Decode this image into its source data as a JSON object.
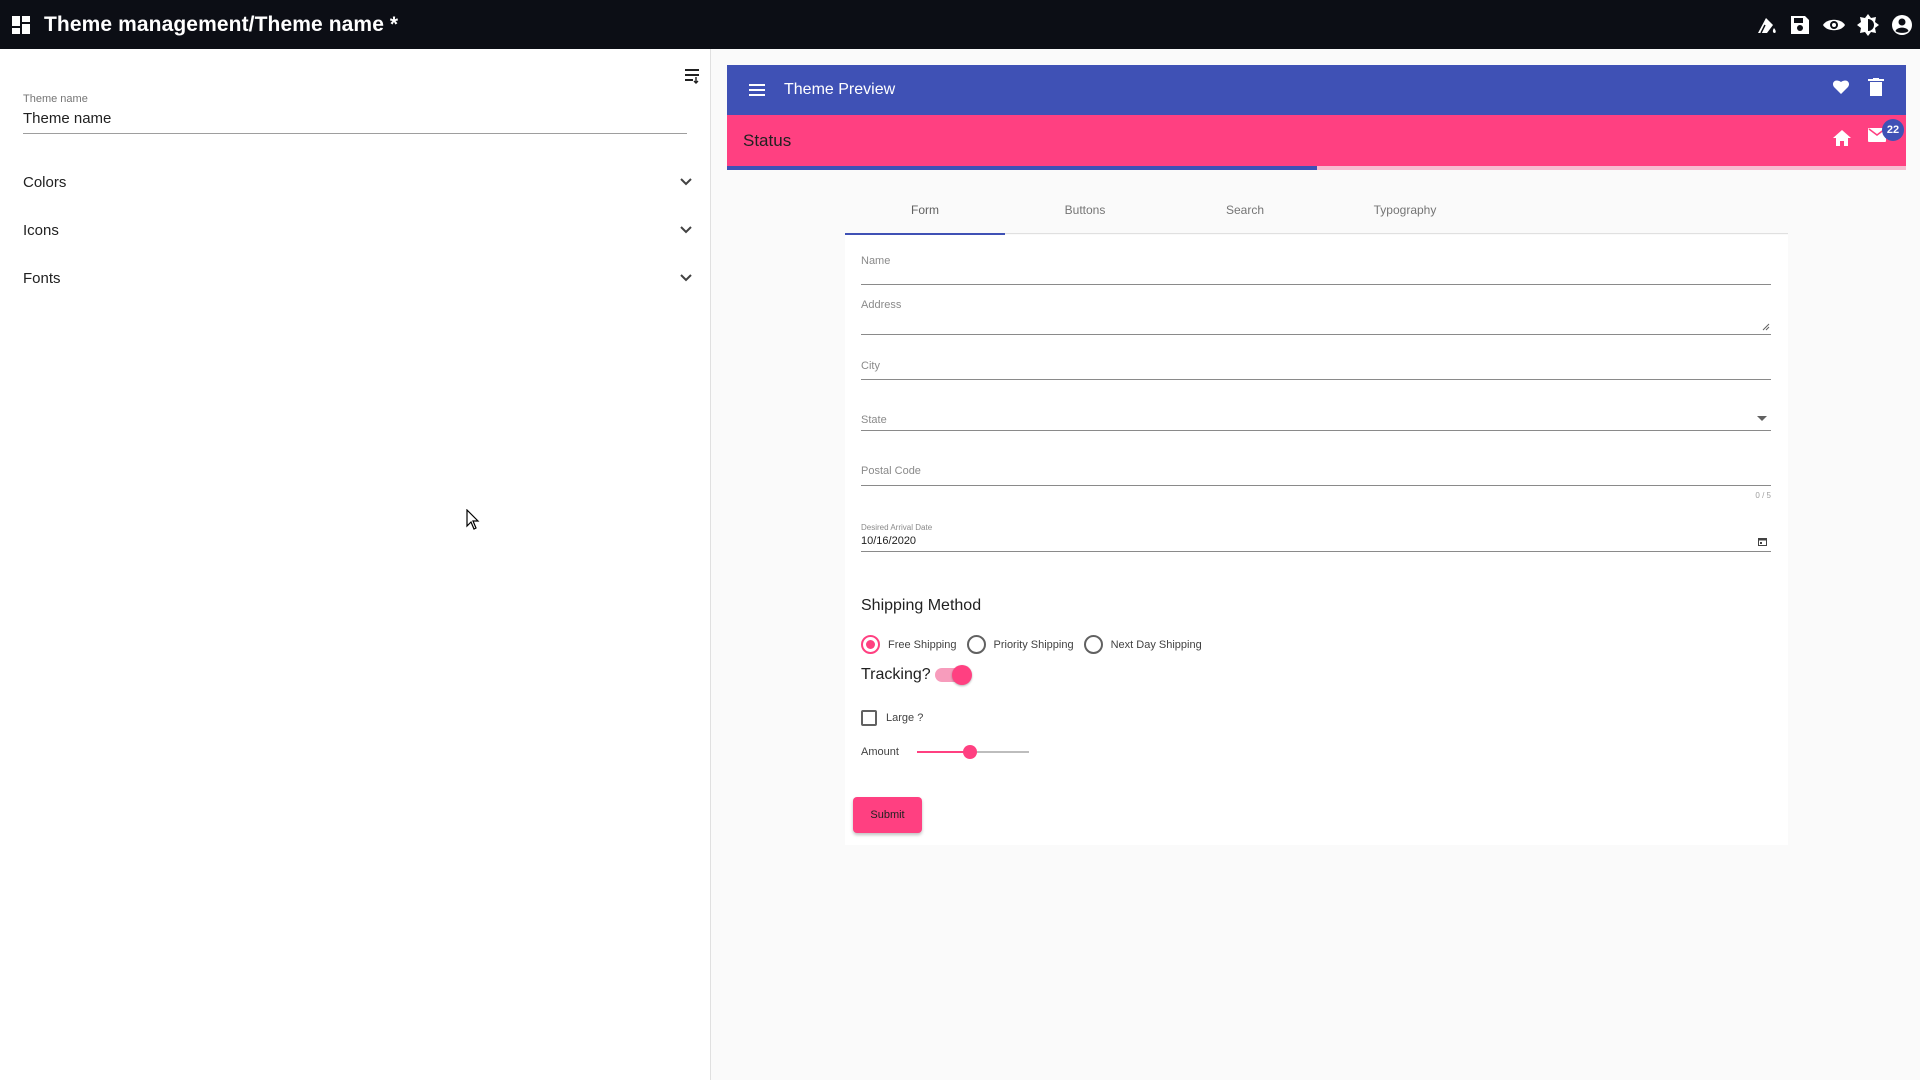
{
  "app": {
    "title": "Theme management/Theme name *",
    "apps_icon": "dashboard-icon",
    "actions": [
      {
        "name": "fill-drip-icon",
        "label": "Styles"
      },
      {
        "name": "save-icon",
        "label": "Save"
      },
      {
        "name": "eye-icon",
        "label": "Preview"
      },
      {
        "name": "brightness-icon",
        "label": "Theme mode"
      },
      {
        "name": "account-icon",
        "label": "Account"
      }
    ]
  },
  "sidebar": {
    "theme_name_label": "Theme name",
    "theme_name_value": "Theme name",
    "sections": [
      {
        "label": "Colors"
      },
      {
        "label": "Icons"
      },
      {
        "label": "Fonts"
      }
    ]
  },
  "preview": {
    "toolbar_title": "Theme Preview",
    "status_title": "Status",
    "badge_count": "22",
    "progress_fraction": 0.5,
    "tabs": [
      {
        "label": "Form",
        "active": true
      },
      {
        "label": "Buttons",
        "active": false
      },
      {
        "label": "Search",
        "active": false
      },
      {
        "label": "Typography",
        "active": false
      }
    ],
    "form": {
      "name_placeholder": "Name",
      "address_placeholder": "Address",
      "city_placeholder": "City",
      "state_placeholder": "State",
      "postal_placeholder": "Postal Code",
      "postal_hint": "0 / 5",
      "date_label": "Desired Arrival Date",
      "date_value": "10/16/2020",
      "shipping_title": "Shipping Method",
      "shipping_options": [
        {
          "label": "Free Shipping",
          "selected": true
        },
        {
          "label": "Priority Shipping",
          "selected": false
        },
        {
          "label": "Next Day Shipping",
          "selected": false
        }
      ],
      "tracking_label": "Tracking?",
      "tracking_on": true,
      "large_label": "Large ?",
      "large_checked": false,
      "amount_label": "Amount",
      "amount_fraction": 0.47,
      "submit_label": "Submit"
    }
  },
  "colors": {
    "primary": "#3f51b5",
    "accent": "#ff4081",
    "topbar": "#0c0e15"
  }
}
